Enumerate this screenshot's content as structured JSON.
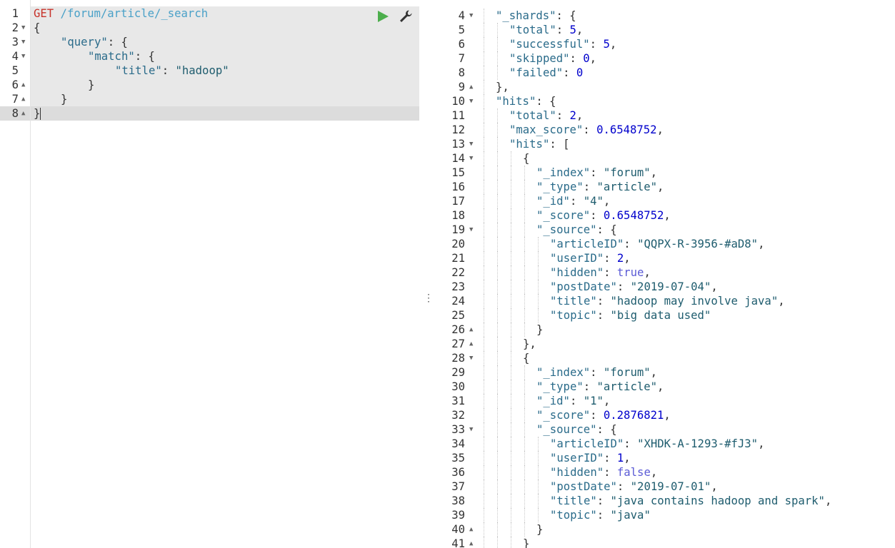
{
  "request": {
    "method": "GET",
    "path": "/forum/article/_search",
    "lines": [
      {
        "n": "1",
        "fold": "",
        "indent": 0,
        "text": ""
      },
      {
        "n": "2",
        "fold": "▼",
        "indent": 0,
        "text": "{"
      },
      {
        "n": "3",
        "fold": "▼",
        "indent": 1,
        "text": "\"query\": {"
      },
      {
        "n": "4",
        "fold": "▼",
        "indent": 2,
        "text": "\"match\": {"
      },
      {
        "n": "5",
        "fold": "",
        "indent": 3,
        "text": "\"title\": \"hadoop\""
      },
      {
        "n": "6",
        "fold": "▲",
        "indent": 2,
        "text": "}"
      },
      {
        "n": "7",
        "fold": "▲",
        "indent": 1,
        "text": "}"
      },
      {
        "n": "8",
        "fold": "▲",
        "indent": 0,
        "text": "}"
      }
    ]
  },
  "toolbar": {
    "run_icon": "play-icon",
    "settings_icon": "wrench-icon",
    "run_color": "#4cae4c"
  },
  "divider_icon": "vertical-ellipsis-icon",
  "response": {
    "lines": [
      {
        "n": "4",
        "fold": "▼",
        "indent": 1,
        "text": "\"_shards\": {"
      },
      {
        "n": "5",
        "fold": "",
        "indent": 2,
        "text": "\"total\": 5,"
      },
      {
        "n": "6",
        "fold": "",
        "indent": 2,
        "text": "\"successful\": 5,"
      },
      {
        "n": "7",
        "fold": "",
        "indent": 2,
        "text": "\"skipped\": 0,"
      },
      {
        "n": "8",
        "fold": "",
        "indent": 2,
        "text": "\"failed\": 0"
      },
      {
        "n": "9",
        "fold": "▲",
        "indent": 1,
        "text": "},"
      },
      {
        "n": "10",
        "fold": "▼",
        "indent": 1,
        "text": "\"hits\": {"
      },
      {
        "n": "11",
        "fold": "",
        "indent": 2,
        "text": "\"total\": 2,"
      },
      {
        "n": "12",
        "fold": "",
        "indent": 2,
        "text": "\"max_score\": 0.6548752,"
      },
      {
        "n": "13",
        "fold": "▼",
        "indent": 2,
        "text": "\"hits\": ["
      },
      {
        "n": "14",
        "fold": "▼",
        "indent": 3,
        "text": "{"
      },
      {
        "n": "15",
        "fold": "",
        "indent": 4,
        "text": "\"_index\": \"forum\","
      },
      {
        "n": "16",
        "fold": "",
        "indent": 4,
        "text": "\"_type\": \"article\","
      },
      {
        "n": "17",
        "fold": "",
        "indent": 4,
        "text": "\"_id\": \"4\","
      },
      {
        "n": "18",
        "fold": "",
        "indent": 4,
        "text": "\"_score\": 0.6548752,"
      },
      {
        "n": "19",
        "fold": "▼",
        "indent": 4,
        "text": "\"_source\": {"
      },
      {
        "n": "20",
        "fold": "",
        "indent": 5,
        "text": "\"articleID\": \"QQPX-R-3956-#aD8\","
      },
      {
        "n": "21",
        "fold": "",
        "indent": 5,
        "text": "\"userID\": 2,"
      },
      {
        "n": "22",
        "fold": "",
        "indent": 5,
        "text": "\"hidden\": true,"
      },
      {
        "n": "23",
        "fold": "",
        "indent": 5,
        "text": "\"postDate\": \"2019-07-04\","
      },
      {
        "n": "24",
        "fold": "",
        "indent": 5,
        "text": "\"title\": \"hadoop may involve java\","
      },
      {
        "n": "25",
        "fold": "",
        "indent": 5,
        "text": "\"topic\": \"big data used\""
      },
      {
        "n": "26",
        "fold": "▲",
        "indent": 4,
        "text": "}"
      },
      {
        "n": "27",
        "fold": "▲",
        "indent": 3,
        "text": "},"
      },
      {
        "n": "28",
        "fold": "▼",
        "indent": 3,
        "text": "{"
      },
      {
        "n": "29",
        "fold": "",
        "indent": 4,
        "text": "\"_index\": \"forum\","
      },
      {
        "n": "30",
        "fold": "",
        "indent": 4,
        "text": "\"_type\": \"article\","
      },
      {
        "n": "31",
        "fold": "",
        "indent": 4,
        "text": "\"_id\": \"1\","
      },
      {
        "n": "32",
        "fold": "",
        "indent": 4,
        "text": "\"_score\": 0.2876821,"
      },
      {
        "n": "33",
        "fold": "▼",
        "indent": 4,
        "text": "\"_source\": {"
      },
      {
        "n": "34",
        "fold": "",
        "indent": 5,
        "text": "\"articleID\": \"XHDK-A-1293-#fJ3\","
      },
      {
        "n": "35",
        "fold": "",
        "indent": 5,
        "text": "\"userID\": 1,"
      },
      {
        "n": "36",
        "fold": "",
        "indent": 5,
        "text": "\"hidden\": false,"
      },
      {
        "n": "37",
        "fold": "",
        "indent": 5,
        "text": "\"postDate\": \"2019-07-01\","
      },
      {
        "n": "38",
        "fold": "",
        "indent": 5,
        "text": "\"title\": \"java contains hadoop and spark\","
      },
      {
        "n": "39",
        "fold": "",
        "indent": 5,
        "text": "\"topic\": \"java\""
      },
      {
        "n": "40",
        "fold": "▲",
        "indent": 4,
        "text": "}"
      },
      {
        "n": "41",
        "fold": "▲",
        "indent": 3,
        "text": "}"
      }
    ]
  }
}
